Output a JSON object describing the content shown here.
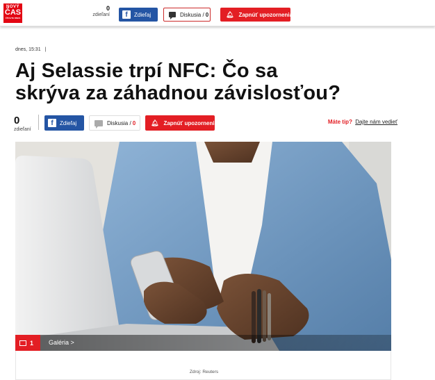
{
  "topbar": {
    "logo": {
      "line1": "NOVÝ",
      "line2": "ČAS",
      "line3": "ČÍTAJTE DNES"
    },
    "share_count": {
      "value": "0",
      "label": "zdieľaní"
    },
    "share_button": "Zdieľaj",
    "discussion_button": {
      "label": "Diskusia /",
      "count": "0"
    },
    "notify_button": "Zapnúť upozornenia"
  },
  "article": {
    "timestamp": "dnes, 15:31",
    "timestamp_sep": "|",
    "headline": "Aj Selassie trpí NFC: Čo sa skrýva za záhadnou závislosťou?",
    "share_count": {
      "value": "0",
      "label": "zdieľaní"
    },
    "share_button": "Zdieľaj",
    "discussion_button": {
      "label": "Diskusia /",
      "count": "0"
    },
    "notify_button": "Zapnúť upozornenia",
    "tip": {
      "question": "Máte tip?",
      "link": "Dajte nám vedieť"
    }
  },
  "gallery": {
    "count": "1",
    "label": "Galéria >"
  },
  "image": {
    "source": "Zdroj: Reuters"
  },
  "colors": {
    "accent": "#e31e24",
    "facebook": "#2455a4",
    "shirt": "#7ea6cc"
  },
  "icons": [
    "facebook-icon",
    "comment-icon",
    "bell-icon",
    "gallery-icon"
  ]
}
